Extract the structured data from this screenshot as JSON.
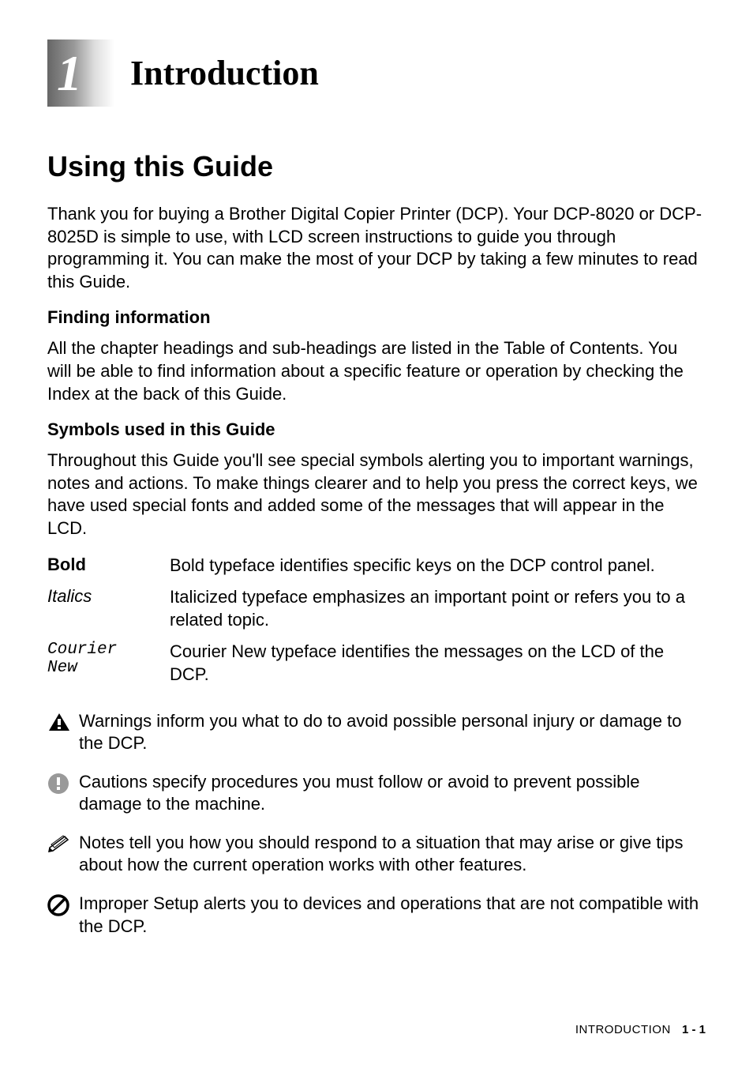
{
  "chapter": {
    "number": "1",
    "title": "Introduction"
  },
  "section": {
    "title": "Using this Guide",
    "intro": "Thank you for buying a Brother Digital Copier Printer (DCP). Your DCP-8020 or DCP-8025D is simple to use, with LCD screen instructions to guide you through programming it. You can make the most of your DCP by taking a few minutes to read this Guide."
  },
  "subsections": {
    "finding": {
      "title": "Finding information",
      "text": "All the chapter headings and sub-headings are listed in the Table of Contents. You will be able to find information about a specific feature or operation by checking the Index at the back of this Guide."
    },
    "symbols": {
      "title": "Symbols used in this Guide",
      "text": "Throughout this Guide you'll see special symbols alerting you to important warnings, notes and actions. To make things clearer and to help you press the correct keys, we have used special fonts and added some of the messages that will appear in the LCD."
    }
  },
  "definitions": {
    "bold": {
      "term": "Bold",
      "desc": "Bold typeface identifies specific keys on the DCP control panel."
    },
    "italics": {
      "term": "Italics",
      "desc": "Italicized typeface emphasizes an important point or refers you to a related topic."
    },
    "courier": {
      "term_line1": "Courier",
      "term_line2": "New",
      "desc": "Courier New typeface identifies the messages on the LCD of the DCP."
    }
  },
  "notices": {
    "warning": "Warnings inform you what to do to avoid possible personal injury or damage to the DCP.",
    "caution": "Cautions specify procedures you must follow or avoid to prevent possible damage to the machine.",
    "note": "Notes tell you how you should respond to a situation that may arise or give tips about how the current operation works with other features.",
    "improper": "Improper Setup alerts you to devices and operations that are not compatible with the DCP."
  },
  "footer": {
    "text": "INTRODUCTION",
    "page": "1 - 1"
  }
}
